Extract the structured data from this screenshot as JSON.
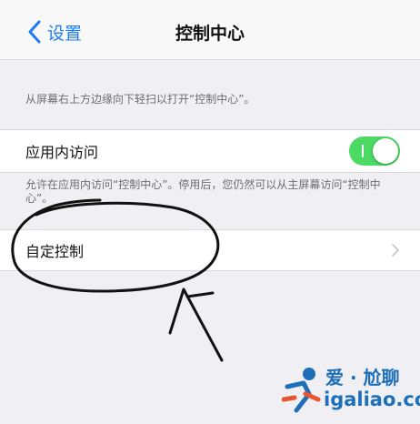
{
  "navbar": {
    "back_label": "设置",
    "title": "控制中心"
  },
  "hint_top": "从屏幕右上方边缘向下轻扫以打开“控制中心”。",
  "access_in_apps": {
    "label": "应用内访问",
    "toggle_state": "on",
    "footer": "允许在应用内访问“控制中心”。停用后，您仍然可以从主屏幕访问“控制中心”。"
  },
  "customize": {
    "label": "自定控制"
  },
  "watermark": {
    "brand": "爱 · 尬聊",
    "domain": "igaliao.com"
  },
  "colors": {
    "accent": "#1b7cf5",
    "toggle_on": "#4cd964",
    "background": "#efeff4",
    "watermark": "#1d6fb8",
    "watermark_accent": "#e8552f"
  }
}
